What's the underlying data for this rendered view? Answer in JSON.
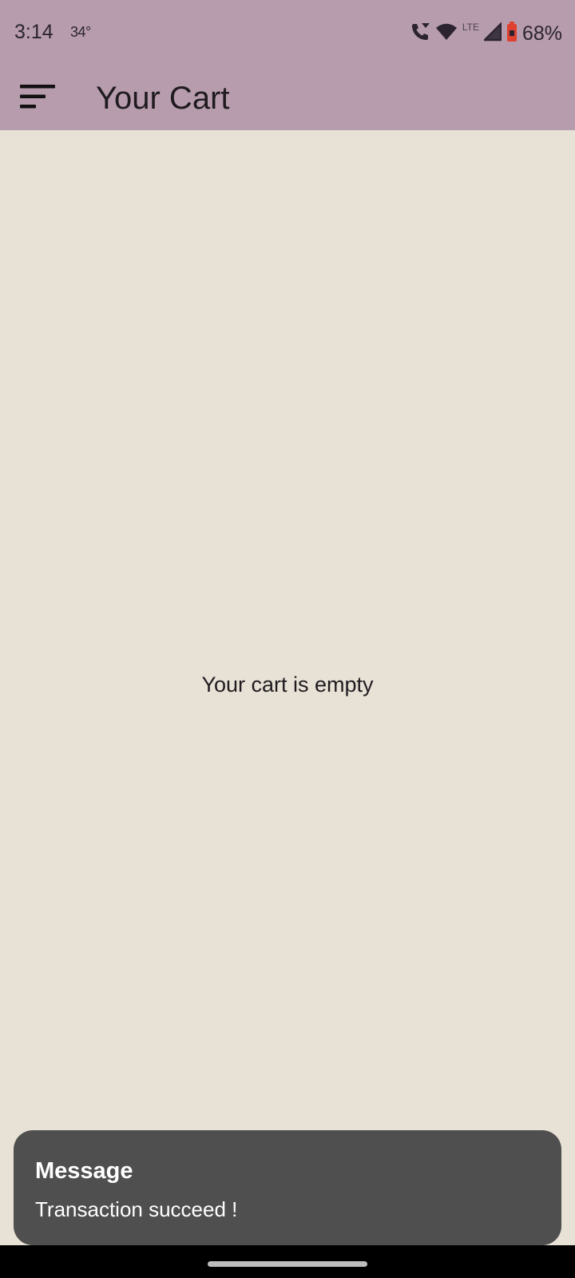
{
  "status_bar": {
    "time": "3:14",
    "temperature": "34°",
    "network": "LTE",
    "battery": "68%",
    "icons": [
      "wifi-calling-icon",
      "wifi-icon",
      "cell-signal-icon",
      "battery-saver-icon"
    ],
    "battery_color": "#e0402f"
  },
  "app_bar": {
    "menu_icon": "sort-menu-icon",
    "title": "Your Cart",
    "color": "#b79cad"
  },
  "main": {
    "empty_message": "Your cart is empty",
    "background": "#e8e1d6"
  },
  "snackbar": {
    "title": "Message",
    "text": "Transaction succeed !",
    "background": "#4f4f4f"
  }
}
